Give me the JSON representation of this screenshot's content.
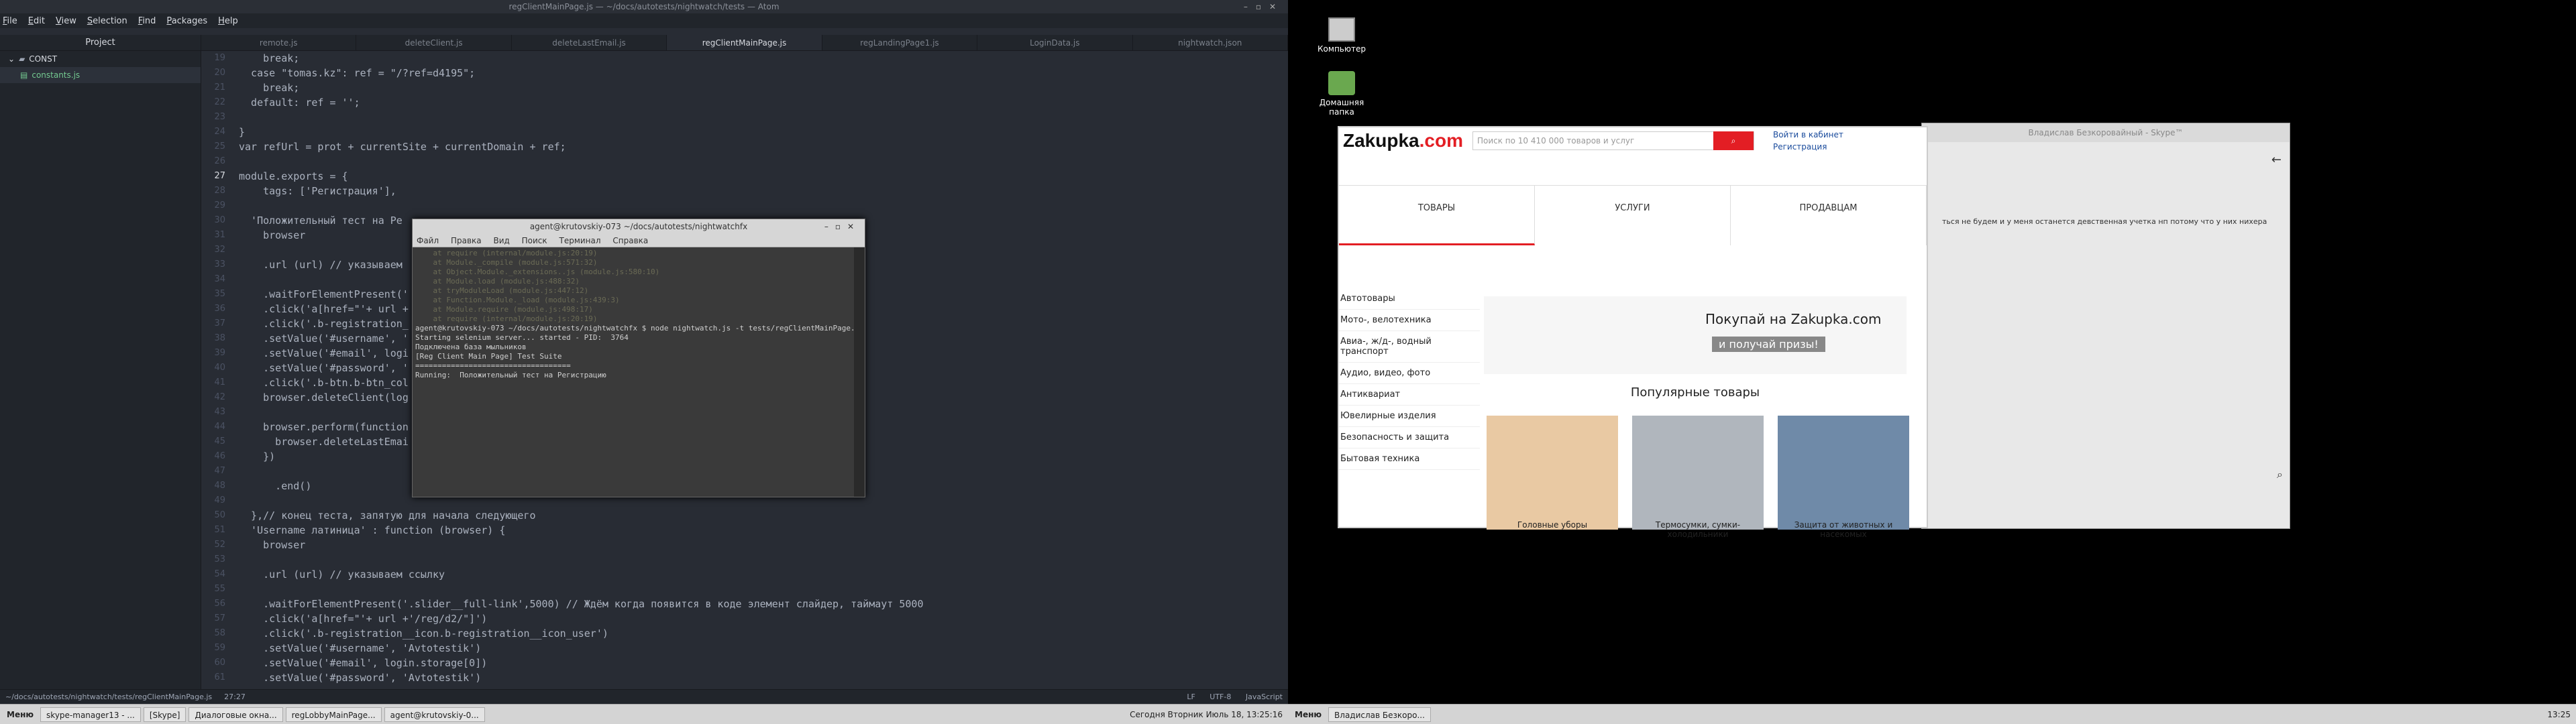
{
  "atom": {
    "title": "regClientMainPage.js — ~/docs/autotests/nightwatch/tests — Atom",
    "menu": [
      "File",
      "Edit",
      "View",
      "Selection",
      "Find",
      "Packages",
      "Help"
    ],
    "tree_title": "Project",
    "tree": [
      {
        "label": "CONST"
      },
      {
        "label": "constants.js"
      }
    ],
    "tabs": [
      "remote.js",
      "deleteClient.js",
      "deleteLastEmail.js",
      "regClientMainPage.js",
      "regLandingPage1.js",
      "LoginData.js",
      "nightwatch.json"
    ],
    "line_numbers": [
      "19",
      "20",
      "21",
      "22",
      "23",
      "24",
      "25",
      "26",
      "27",
      "28",
      "29",
      "30",
      "31",
      "32",
      "33",
      "34",
      "35",
      "36",
      "37",
      "38",
      "39",
      "40",
      "41",
      "42",
      "43",
      "44",
      "45",
      "46",
      "47",
      "48",
      "49",
      "50",
      "51",
      "52",
      "53",
      "54",
      "55",
      "56",
      "57",
      "58",
      "59",
      "60",
      "61"
    ],
    "status": {
      "path": "~/docs/autotests/nightwatch/tests/regClientMainPage.js",
      "cursor": "27:27",
      "eol": "LF",
      "encoding": "UTF-8",
      "grammar": "JavaScript"
    }
  },
  "code": [
    "    break;",
    "  case \"tomas.kz\": ref = \"/?ref=d4195\";",
    "    break;",
    "  default: ref = '';",
    "",
    "}",
    "var refUrl = prot + currentSite + currentDomain + ref;",
    "",
    "module.exports = {",
    "    tags: ['Регистрация'],",
    "",
    "  'Положительный тест на Ре",
    "    browser",
    "",
    "    .url (url) // указываем",
    "",
    "    .waitForElementPresent('",
    "    .click('a[href=\"'+ url +",
    "    .click('.b-registration_",
    "    .setValue('#username', '",
    "    .setValue('#email', logi",
    "    .setValue('#password', '",
    "    .click('.b-btn.b-btn_col",
    "    browser.deleteClient(log",
    "",
    "    browser.perform(function",
    "      browser.deleteLastEmai",
    "    })",
    "",
    "      .end()",
    "",
    "  },// конец теста, запятую для начала следующего",
    "  'Username латиница' : function (browser) {",
    "    browser",
    "",
    "    .url (url) // указываем ссылку",
    "",
    "    .waitForElementPresent('.slider__full-link',5000) // Ждём когда появится в коде элемент слайдер, таймаут 5000",
    "    .click('a[href=\"'+ url +'/reg/d2/\"]')",
    "    .click('.b-registration__icon.b-registration__icon_user')",
    "    .setValue('#username', 'Avtotestik')",
    "    .setValue('#email', login.storage[0])",
    "    .setValue('#password', 'Avtotestik')"
  ],
  "terminal": {
    "title": "agent@krutovskiy-073 ~/docs/autotests/nightwatchfx",
    "menu": [
      "Файл",
      "Правка",
      "Вид",
      "Поиск",
      "Терминал",
      "Справка"
    ],
    "lines": [
      {
        "t": "    at require (internal/module.js:20:19)",
        "dim": true
      },
      {
        "t": "    at Module._compile (module.js:571:32)",
        "dim": true
      },
      {
        "t": "    at Object.Module._extensions..js (module.js:580:10)",
        "dim": true
      },
      {
        "t": "    at Module.load (module.js:488:32)",
        "dim": true
      },
      {
        "t": "    at tryModuleLoad (module.js:447:12)",
        "dim": true
      },
      {
        "t": "    at Function.Module._load (module.js:439:3)",
        "dim": true
      },
      {
        "t": "    at Module.require (module.js:498:17)",
        "dim": true
      },
      {
        "t": "    at require (internal/module.js:20:19)",
        "dim": true
      },
      {
        "t": "",
        "dim": true
      },
      {
        "t": "",
        "dim": true
      },
      {
        "t": "",
        "dim": true
      },
      {
        "t": "",
        "dim": true
      },
      {
        "t": "",
        "dim": true
      },
      {
        "t": "agent@krutovskiy-073 ~/docs/autotests/nightwatchfx $ node nightwatch.js -t tests/regClientMainPage.js",
        "dim": false
      },
      {
        "t": "Starting selenium server... started - PID:  3764",
        "dim": false
      },
      {
        "t": "Подключена база мыльников",
        "dim": false
      },
      {
        "t": "",
        "dim": false
      },
      {
        "t": "[Reg Client Main Page] Test Suite",
        "dim": false
      },
      {
        "t": "===================================",
        "dim": false
      },
      {
        "t": "",
        "dim": false
      },
      {
        "t": "Running:  Положительный тест на Регистрацию",
        "dim": false
      }
    ]
  },
  "desktop": {
    "icons": [
      {
        "label": "Компьютер"
      },
      {
        "label": "Домашняя папка"
      }
    ]
  },
  "browser": {
    "logo_pre": "Zakupka",
    "logo_post": ".com",
    "search_placeholder": "Поиск по 10 410 000 товаров и услуг",
    "login": "Войти в кабинет",
    "register": "Регистрация",
    "nav": [
      "ТОВАРЫ",
      "УСЛУГИ",
      "ПРОДАВЦАМ"
    ],
    "categories": [
      "Автотовары",
      "Мото-, велотехника",
      "Авиа-, ж/д-, водный транспорт",
      "Аудио, видео, фото",
      "Антиквариат",
      "Ювелирные изделия",
      "Безопасность и защита",
      "Бытовая техника"
    ],
    "banner": "Покупай на Zakupka.com",
    "banner_sub": "и получай призы!",
    "popular": "Популярные товары",
    "products": [
      "Головные уборы",
      "Термосумки, сумки-холодильники",
      "Защита от животных и насекомых"
    ]
  },
  "skype": {
    "title": "Владислав Безкоровайный - Skype™",
    "message": "ться не будем и у меня останется девственная учетка нп потому что у них нихера"
  },
  "taskbar_left": {
    "menu": "Меню",
    "items": [
      "skype-manager13 - ...",
      "[Skype]",
      "Диалоговые окна...",
      "regLobbyMainPage...",
      "agent@krutovskiy-0..."
    ],
    "clock": "Сегодня Вторник Июль 18, 13:25:16"
  },
  "taskbar_right": {
    "menu": "Меню",
    "items": [
      "Владислав Безкоро..."
    ],
    "clock": "13:25"
  }
}
